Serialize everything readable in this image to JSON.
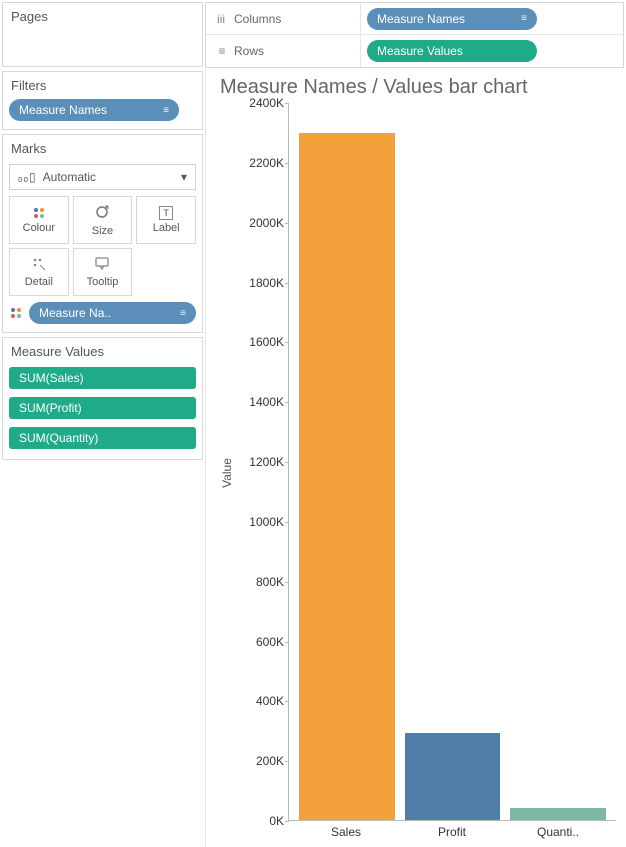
{
  "pages": {
    "label": "Pages"
  },
  "shelves": {
    "columns": {
      "label": "Columns",
      "pill": "Measure Names",
      "pill_color": "blue"
    },
    "rows": {
      "label": "Rows",
      "pill": "Measure Values",
      "pill_color": "teal"
    }
  },
  "filters": {
    "label": "Filters",
    "items": [
      {
        "label": "Measure Names",
        "color": "blue"
      }
    ]
  },
  "marks": {
    "label": "Marks",
    "mark_type": "Automatic",
    "buttons": {
      "colour": "Colour",
      "size": "Size",
      "label": "Label",
      "detail": "Detail",
      "tooltip": "Tooltip"
    },
    "encoding_pill": "Measure Na.."
  },
  "measure_values": {
    "label": "Measure Values",
    "items": [
      "SUM(Sales)",
      "SUM(Profit)",
      "SUM(Quantity)"
    ]
  },
  "viz": {
    "title": "Measure Names / Values bar chart",
    "ylabel": "Value"
  },
  "chart_data": {
    "type": "bar",
    "title": "Measure Names / Values bar chart",
    "ylabel": "Value",
    "xlabel": "",
    "ylim": [
      0,
      2400000
    ],
    "categories": [
      "Sales",
      "Profit",
      "Quanti.."
    ],
    "values": [
      2300000,
      290000,
      40000
    ],
    "colors": [
      "#f2a13b",
      "#4f7ea8",
      "#7fb9a6"
    ],
    "yticks": [
      0,
      200000,
      400000,
      600000,
      800000,
      1000000,
      1200000,
      1400000,
      1600000,
      1800000,
      2000000,
      2200000,
      2400000
    ],
    "ytick_labels": [
      "0K",
      "200K",
      "400K",
      "600K",
      "800K",
      "1000K",
      "1200K",
      "1400K",
      "1600K",
      "1800K",
      "2000K",
      "2200K",
      "2400K"
    ]
  }
}
